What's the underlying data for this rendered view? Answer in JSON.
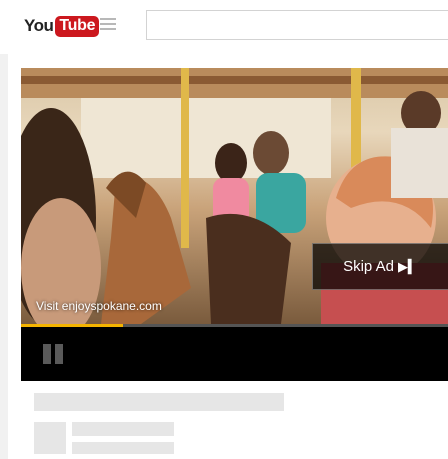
{
  "header": {
    "logo": {
      "you": "You",
      "tube": "Tube"
    },
    "search": {
      "placeholder": ""
    }
  },
  "player": {
    "ad_link_text": "Visit enjoyspokane.com",
    "skip_label": "Skip Ad",
    "skip_icon": "▶▍",
    "progress": 0.24,
    "progress_color": "#f5b400"
  },
  "colors": {
    "brand_red": "#cc181e",
    "page_bg": "#f1f1f1"
  }
}
